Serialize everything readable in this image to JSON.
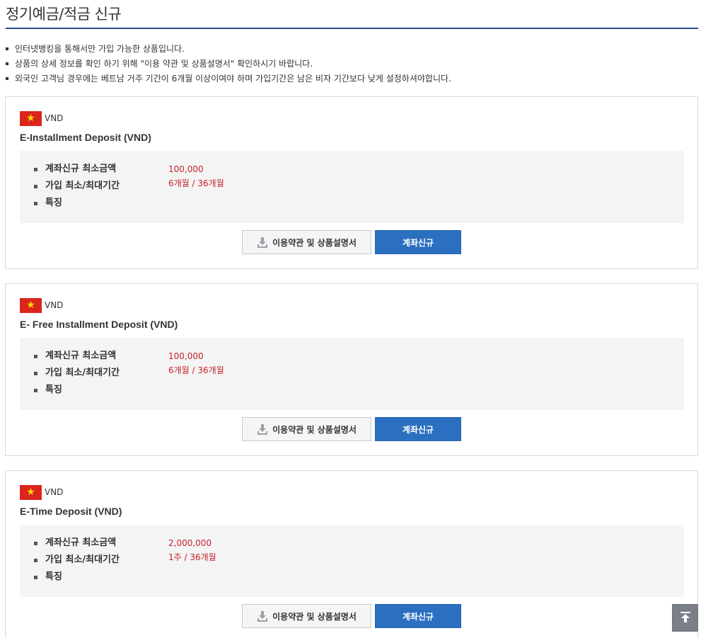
{
  "page": {
    "title": "정기예금/적금 신규"
  },
  "notices": [
    "인터넷뱅킹을 통해서만 가입 가능한 상품입니다.",
    "상품의 상세 정보를 확인 하기 위해 \"이용 약관 및 상품설명서\" 확인하시기 바랍니다.",
    "외국인 고객님 경우에는 베트남 거주 기간이 6개월 이상이여야 하며 가입기간은 남은 비자 기간보다 낮게 설정하셔야합니다."
  ],
  "labels": {
    "min_amount": "계좌신규 최소금액",
    "period": "가입 최소/최대기간",
    "features": "특징",
    "terms_button": "이용약관 및 상품설명서",
    "open_button": "계좌신규"
  },
  "products": [
    {
      "currency": "VND",
      "name": "E-Installment Deposit (VND)",
      "min_amount": "100,000",
      "period": "6개월 / 36개월",
      "features": ""
    },
    {
      "currency": "VND",
      "name": "E- Free Installment Deposit (VND)",
      "min_amount": "100,000",
      "period": "6개월 / 36개월",
      "features": ""
    },
    {
      "currency": "VND",
      "name": "E-Time Deposit (VND)",
      "min_amount": "2,000,000",
      "period": "1주 / 36개월",
      "features": ""
    }
  ],
  "colors": {
    "accent_blue": "#2b6fc0",
    "value_red": "#c5222b",
    "title_rule": "#2b4a8b",
    "flag_red": "#da251d",
    "flag_star": "#ffdd00"
  },
  "icons": {
    "flag": "vietnam-flag-icon",
    "download": "download-icon",
    "scroll_top": "arrow-to-top-icon"
  }
}
